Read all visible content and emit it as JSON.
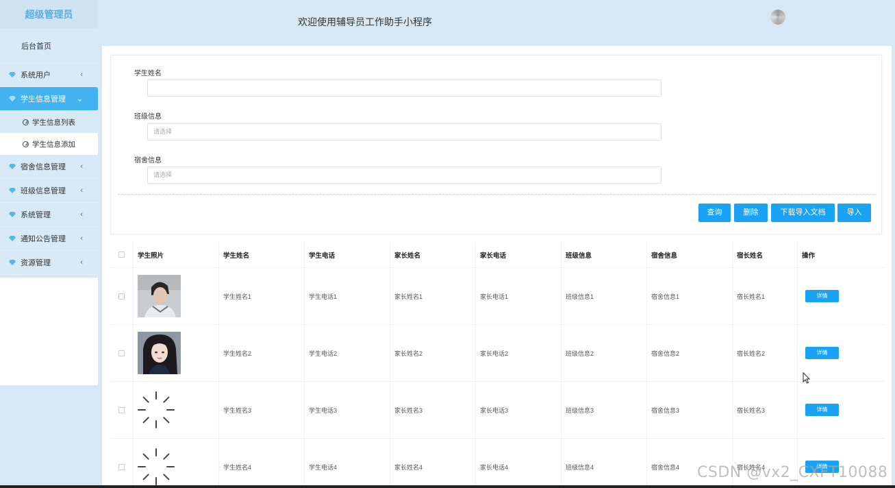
{
  "sidebar": {
    "title": "超级管理员",
    "home": "后台首页",
    "items": [
      {
        "label": "系统用户"
      },
      {
        "label": "学生信息管理"
      },
      {
        "label": "宿舍信息管理"
      },
      {
        "label": "班级信息管理"
      },
      {
        "label": "系统管理"
      },
      {
        "label": "通知公告管理"
      },
      {
        "label": "资源管理"
      }
    ],
    "subitems": [
      {
        "label": "学生信息列表"
      },
      {
        "label": "学生信息添加"
      }
    ]
  },
  "header": {
    "title": "欢迎使用辅导员工作助手小程序"
  },
  "search": {
    "fields": [
      {
        "label": "学生姓名",
        "placeholder": ""
      },
      {
        "label": "班级信息",
        "placeholder": "请选择"
      },
      {
        "label": "宿舍信息",
        "placeholder": "请选择"
      }
    ],
    "buttons": {
      "query": "查询",
      "delete": "删除",
      "download": "下载导入文档",
      "import": "导入"
    }
  },
  "table": {
    "headers": [
      "学生照片",
      "学生姓名",
      "学生电话",
      "家长姓名",
      "家长电话",
      "班级信息",
      "宿舍信息",
      "宿长姓名",
      "操作"
    ],
    "rows": [
      {
        "name": "学生姓名1",
        "phone": "学生电话1",
        "parent": "家长姓名1",
        "parent_phone": "家长电话1",
        "class": "班级信息1",
        "dorm": "宿舍信息1",
        "dorm_leader": "宿长姓名1",
        "action": "详情"
      },
      {
        "name": "学生姓名2",
        "phone": "学生电话2",
        "parent": "家长姓名2",
        "parent_phone": "家长电话2",
        "class": "班级信息2",
        "dorm": "宿舍信息2",
        "dorm_leader": "宿长姓名2",
        "action": "详情"
      },
      {
        "name": "学生姓名3",
        "phone": "学生电话3",
        "parent": "家长姓名3",
        "parent_phone": "家长电话3",
        "class": "班级信息3",
        "dorm": "宿舍信息3",
        "dorm_leader": "宿长姓名3",
        "action": "详情"
      },
      {
        "name": "学生姓名4",
        "phone": "学生电话4",
        "parent": "家长姓名4",
        "parent_phone": "家长电话4",
        "class": "班级信息4",
        "dorm": "宿舍信息4",
        "dorm_leader": "宿长姓名4",
        "action": "详情"
      }
    ]
  },
  "watermark": "CSDN @vx2_CXFT10088",
  "colors": {
    "accent": "#1aa3f4",
    "sidebar_active": "#42b3f0",
    "title": "#5aaedf",
    "background": "#d6e8f5"
  },
  "icons": {
    "menu": "diamond-icon",
    "submenu": "clock-icon",
    "collapse": "chevron-left-icon",
    "expand": "chevron-down-icon"
  }
}
